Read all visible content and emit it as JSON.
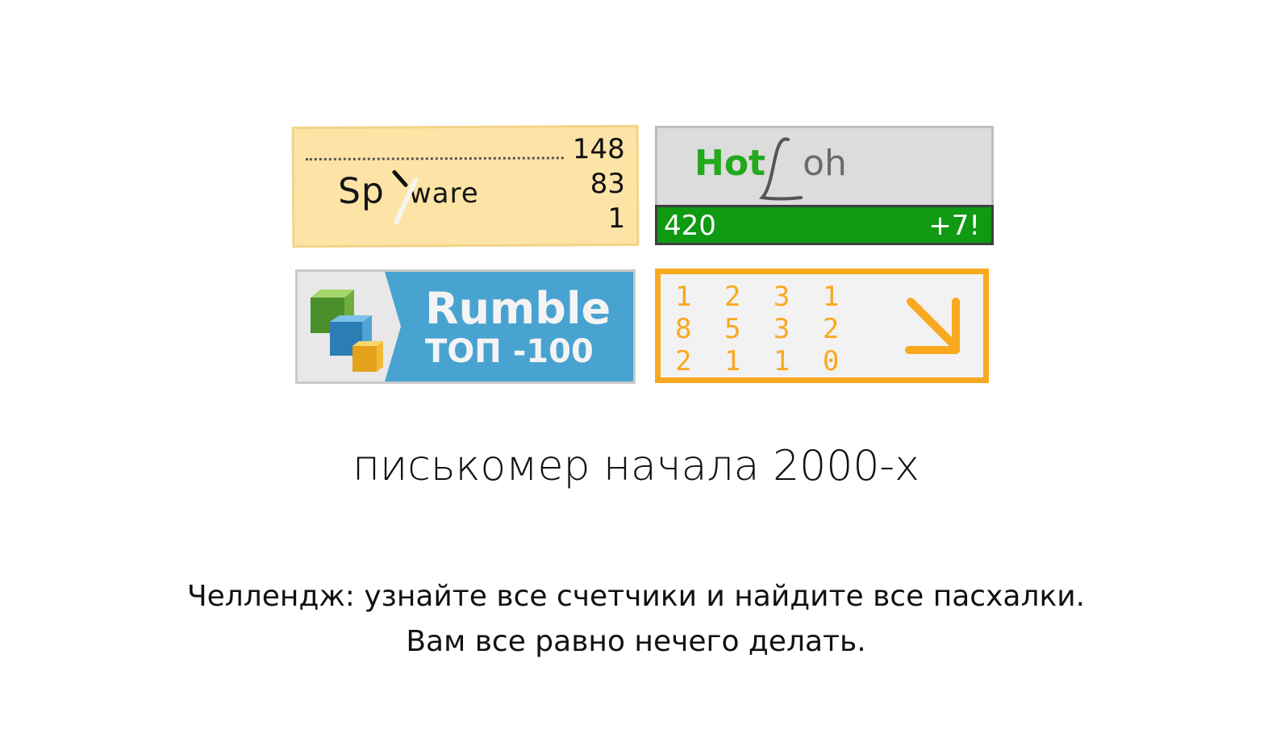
{
  "counters": {
    "spyware": {
      "word_part1": "Sp",
      "word_part2": "ware",
      "stats": [
        "148",
        "83",
        "1"
      ],
      "icon": "spyware-logo"
    },
    "hotlog": {
      "hot": "Hot",
      "log": "oh",
      "value": "420",
      "delta": "+7!",
      "colors": {
        "brand": "#22a91c",
        "bar": "#0f9a12",
        "bg": "#dcdcdc"
      }
    },
    "rumble": {
      "title": "Rumble",
      "subtitle": "ТОП -100",
      "icon": "cubes-icon",
      "colors": {
        "blue": "#49a3d0"
      }
    },
    "orange": {
      "rows": [
        "1 2 3 1",
        "8 5 3 2",
        "2 1 1 0"
      ],
      "icon": "arrow-down-right-icon",
      "colors": {
        "accent": "#f8a91f"
      }
    }
  },
  "caption": "писькомер начала 2000-х",
  "note": {
    "line1": "Челлендж: узнайте все счетчики и найдите все пасхалки.",
    "line2": "Вам все равно нечего делать."
  }
}
